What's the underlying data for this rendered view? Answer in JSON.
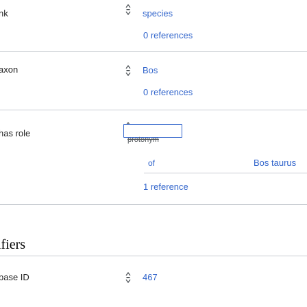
{
  "statements": [
    {
      "property": "nk",
      "value": "species",
      "references": "0 references"
    },
    {
      "property": "axon",
      "value": "Bos",
      "references": "0 references"
    },
    {
      "property": "has role",
      "input_value": "",
      "input_placeholder": "",
      "suggestion": "protonym",
      "qualifier_property": "of",
      "qualifier_value": "Bos taurus",
      "references": "1 reference"
    }
  ],
  "identifiers": {
    "heading": "ifiers",
    "property": "base ID",
    "value": "467"
  },
  "colors": {
    "link": "#3366cc",
    "separator": "#c8ccd1",
    "input_border": "#3366cc",
    "text": "#222222"
  },
  "icons": {
    "rank": "rank-normal-icon"
  }
}
